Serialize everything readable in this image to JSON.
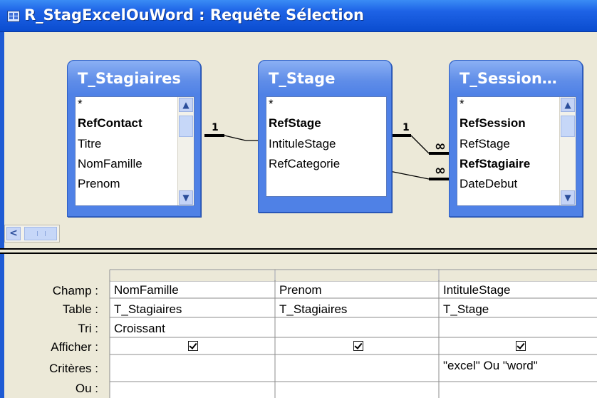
{
  "window": {
    "title": "R_StagExcelOuWord : Requête Sélection"
  },
  "tables": [
    {
      "name": "T_Stagiaires",
      "fields": [
        {
          "label": "*",
          "bold": false
        },
        {
          "label": "RefContact",
          "bold": true
        },
        {
          "label": "Titre",
          "bold": false
        },
        {
          "label": "NomFamille",
          "bold": false
        },
        {
          "label": "Prenom",
          "bold": false
        }
      ]
    },
    {
      "name": "T_Stage",
      "fields": [
        {
          "label": "*",
          "bold": false
        },
        {
          "label": "RefStage",
          "bold": true
        },
        {
          "label": "IntituleStage",
          "bold": false
        },
        {
          "label": "RefCategorie",
          "bold": false
        }
      ]
    },
    {
      "name": "T_Session…",
      "fields": [
        {
          "label": "*",
          "bold": false
        },
        {
          "label": "RefSession",
          "bold": true
        },
        {
          "label": "RefStage",
          "bold": false
        },
        {
          "label": "RefStagiaire",
          "bold": true
        },
        {
          "label": "DateDebut",
          "bold": false
        }
      ]
    }
  ],
  "links": [
    {
      "one": "1",
      "many": ""
    },
    {
      "one": "1",
      "many": "∞"
    },
    {
      "one": "",
      "many": "∞"
    }
  ],
  "grid": {
    "row_labels": [
      "Champ :",
      "Table :",
      "Tri :",
      "Afficher :",
      "Critères :",
      "Ou :"
    ],
    "columns": [
      {
        "champ": "NomFamille",
        "table": "T_Stagiaires",
        "tri": "Croissant",
        "afficher": true,
        "criteres": "",
        "ou": ""
      },
      {
        "champ": "Prenom",
        "table": "T_Stagiaires",
        "tri": "",
        "afficher": true,
        "criteres": "",
        "ou": ""
      },
      {
        "champ": "IntituleStage",
        "table": "T_Stage",
        "tri": "",
        "afficher": true,
        "criteres": "\"excel\" Ou \"word\"",
        "ou": ""
      }
    ]
  }
}
